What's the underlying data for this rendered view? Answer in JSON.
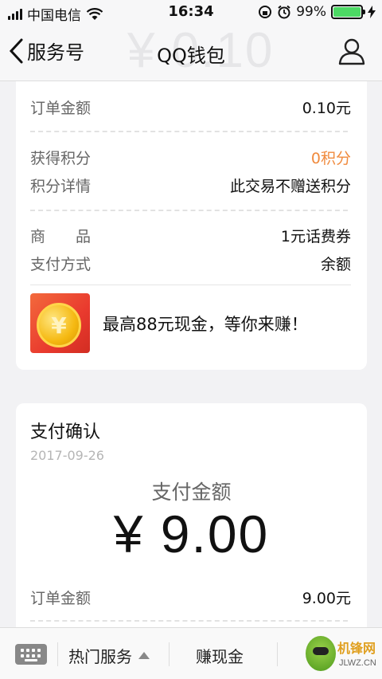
{
  "status_bar": {
    "carrier": "中国电信",
    "time": "16:34",
    "battery_percent": "99%",
    "battery_level": 0.99
  },
  "nav": {
    "back_label": "服务号",
    "title": "QQ钱包",
    "watermark": "¥ 0.10"
  },
  "receipt": {
    "order_amount_label": "订单金额",
    "order_amount_value": "0.10元",
    "points_label": "获得积分",
    "points_value": "0积分",
    "points_detail_label": "积分详情",
    "points_detail_value": "此交易不赠送积分",
    "product_label": "商　　品",
    "product_value": "1元话费券",
    "pay_method_label": "支付方式",
    "pay_method_value": "余额",
    "promo_coin": "¥",
    "promo_text": "最高88元现金，等你来赚！"
  },
  "confirm": {
    "title": "支付确认",
    "date": "2017-09-26",
    "pay_label": "支付金额",
    "pay_amount": "¥ 9.00",
    "order_amount_label": "订单金额",
    "order_amount_value": "9.00元"
  },
  "bottom_bar": {
    "hot_services": "热门服务",
    "earn_cash": "赚现金",
    "brand_cn": "机锋网",
    "brand_en": "JLWZ.CN"
  },
  "colors": {
    "accent_orange": "#f08a3d",
    "battery_green": "#4cd964"
  }
}
